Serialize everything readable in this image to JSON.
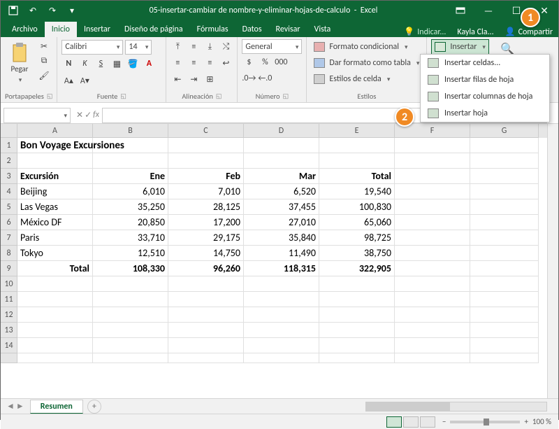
{
  "titlebar": {
    "doc_name": "05-insertar-cambiar de nombre-y-eliminar-hojas-de-calculo",
    "app_name": "Excel"
  },
  "tabs": {
    "archivo": "Archivo",
    "inicio": "Inicio",
    "insertar": "Insertar",
    "diseno": "Diseño de página",
    "formulas": "Fórmulas",
    "datos": "Datos",
    "revisar": "Revisar",
    "vista": "Vista",
    "tell_me": "Indicar...",
    "user": "Kayla Cla...",
    "share": "Compartir"
  },
  "ribbon": {
    "clipboard": {
      "paste": "Pegar",
      "label": "Portapapeles"
    },
    "font": {
      "name": "Calibri",
      "size": "14",
      "bold": "N",
      "italic": "K",
      "underline": "S",
      "label": "Fuente"
    },
    "alignment": {
      "label": "Alineación"
    },
    "number": {
      "format": "General",
      "label": "Número"
    },
    "styles": {
      "cond": "Formato condicional",
      "table": "Dar formato como tabla",
      "cell": "Estilos de celda",
      "label": "Estilos"
    },
    "cells": {
      "insert": "Insertar",
      "menu": {
        "cells": "Insertar celdas...",
        "rows": "Insertar filas de hoja",
        "cols": "Insertar columnas de hoja",
        "sheet": "Insertar hoja"
      }
    }
  },
  "callout1": "1",
  "callout2": "2",
  "formula": {
    "fx": "fx"
  },
  "columns": [
    "A",
    "B",
    "C",
    "D",
    "E",
    "F",
    "G"
  ],
  "sheet": {
    "title": "Bon Voyage Excursiones",
    "headers": {
      "excursion": "Excursión",
      "ene": "Ene",
      "feb": "Feb",
      "mar": "Mar",
      "total": "Total"
    },
    "rows": [
      {
        "name": "Beijing",
        "ene": "6,010",
        "feb": "7,010",
        "mar": "6,520",
        "total": "19,540"
      },
      {
        "name": "Las Vegas",
        "ene": "35,250",
        "feb": "28,125",
        "mar": "37,455",
        "total": "100,830"
      },
      {
        "name": "México DF",
        "ene": "20,850",
        "feb": "17,200",
        "mar": "27,010",
        "total": "65,060"
      },
      {
        "name": "Paris",
        "ene": "33,710",
        "feb": "29,175",
        "mar": "35,840",
        "total": "98,725"
      },
      {
        "name": "Tokyo",
        "ene": "12,510",
        "feb": "14,750",
        "mar": "11,490",
        "total": "38,750"
      }
    ],
    "totals": {
      "label": "Total",
      "ene": "108,330",
      "feb": "96,260",
      "mar": "118,315",
      "total": "322,905"
    }
  },
  "sheet_tab": "Resumen",
  "zoom": "100 %"
}
